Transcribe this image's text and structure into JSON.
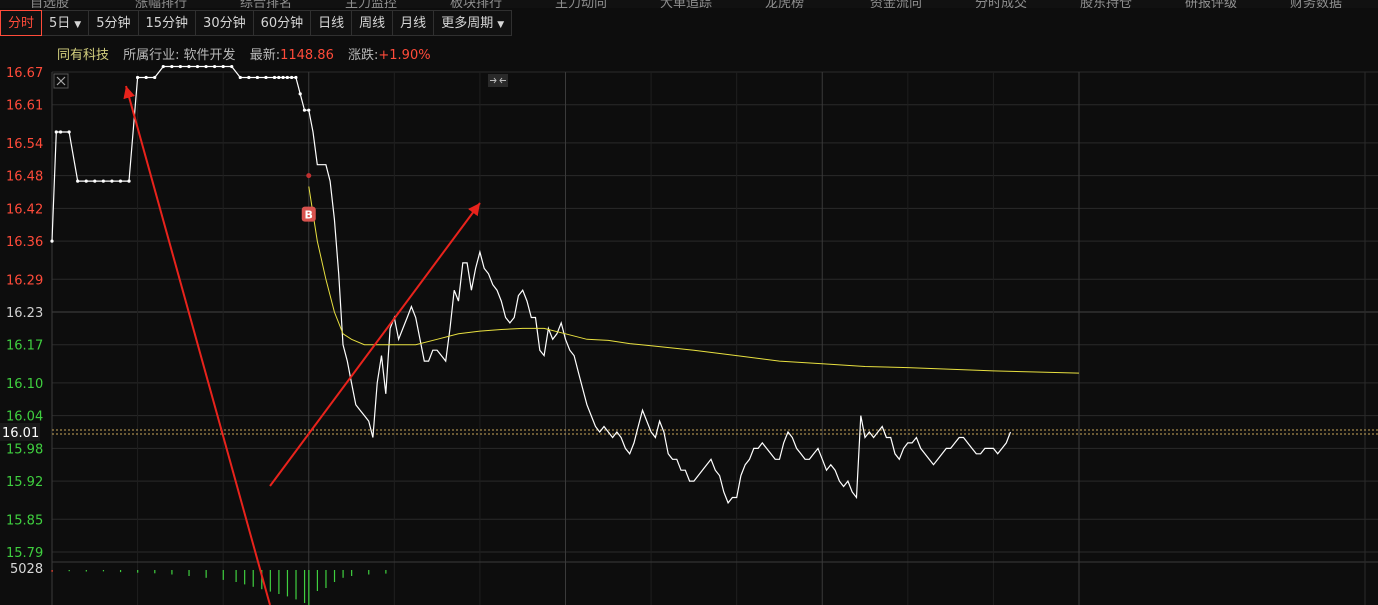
{
  "top_menu": [
    "自选股",
    "涨幅排行",
    "综合排名",
    "主力监控",
    "板块排行",
    "主力动向",
    "大单追踪",
    "龙虎榜",
    "资金流向",
    "分时成交",
    "股东持仓",
    "研报评级",
    "财务数据"
  ],
  "period_tabs": [
    {
      "label": "分时",
      "active": true,
      "dropdown": false
    },
    {
      "label": "5日",
      "active": false,
      "dropdown": true
    },
    {
      "label": "5分钟",
      "active": false,
      "dropdown": false
    },
    {
      "label": "15分钟",
      "active": false,
      "dropdown": false
    },
    {
      "label": "30分钟",
      "active": false,
      "dropdown": false
    },
    {
      "label": "60分钟",
      "active": false,
      "dropdown": false
    },
    {
      "label": "日线",
      "active": false,
      "dropdown": false
    },
    {
      "label": "周线",
      "active": false,
      "dropdown": false
    },
    {
      "label": "月线",
      "active": false,
      "dropdown": false
    },
    {
      "label": "更多周期",
      "active": false,
      "dropdown": true
    }
  ],
  "stock_info": {
    "name": "同有科技",
    "industry_label": "所属行业:",
    "industry": "软件开发",
    "latest_label": "最新:",
    "latest": "1148.86",
    "change_label": "涨跌:",
    "change": "+1.90%"
  },
  "colors": {
    "up": "#ff4b3a",
    "down": "#3fcf3f",
    "price_line": "#ffffff",
    "avg_line": "#e8e040",
    "grid": "#2a2a2a",
    "arrow": "#e8231c"
  },
  "icons": {
    "close": "close-icon",
    "collapse": "collapse-arrows-icon",
    "buy_marker": "buy-marker-icon"
  },
  "buy_marker_label": "B",
  "current_price_label": "16.01",
  "volume_axis_label": "5028",
  "chart_data": {
    "type": "line",
    "title": "",
    "xlabel": "",
    "ylabel": "",
    "ylim": [
      15.79,
      16.67
    ],
    "yticks": [
      16.67,
      16.61,
      16.54,
      16.48,
      16.42,
      16.36,
      16.29,
      16.23,
      16.17,
      16.1,
      16.04,
      15.98,
      15.92,
      15.85,
      15.79
    ],
    "prev_close": 16.23,
    "current_price": 16.01,
    "x_min": 0,
    "x_max": 480,
    "session_break": 120,
    "buy_marker": {
      "x": 120,
      "y": 16.48
    },
    "price_series": {
      "x": [
        0,
        2,
        4,
        8,
        12,
        16,
        20,
        24,
        28,
        32,
        36,
        40,
        44,
        48,
        52,
        56,
        60,
        64,
        68,
        72,
        76,
        80,
        84,
        88,
        92,
        96,
        100,
        104,
        106,
        108,
        110,
        112,
        114,
        116,
        118,
        120,
        122,
        124,
        126,
        128,
        130,
        132,
        134,
        136,
        138,
        140,
        142,
        144,
        146,
        148,
        150,
        152,
        154,
        156,
        158,
        160,
        162,
        164,
        166,
        168,
        170,
        172,
        174,
        176,
        178,
        180,
        182,
        184,
        186,
        188,
        190,
        192,
        194,
        196,
        198,
        200,
        202,
        204,
        206,
        208,
        210,
        212,
        214,
        216,
        218,
        220,
        222,
        224,
        226,
        228,
        230,
        232,
        234,
        236,
        238,
        240,
        242,
        244,
        246,
        248,
        250,
        252,
        254,
        256,
        258,
        260,
        262,
        264,
        266,
        268,
        270,
        272,
        274,
        276,
        278,
        280,
        282,
        284,
        286,
        288,
        290,
        292,
        294,
        296,
        298,
        300,
        302,
        304,
        306,
        308,
        310,
        312,
        314,
        316,
        318,
        320,
        322,
        324,
        326,
        328,
        330,
        332,
        334,
        336,
        338,
        340,
        342,
        344,
        346,
        348,
        350,
        352,
        354,
        356,
        358,
        360,
        362,
        364,
        366,
        368,
        370,
        372,
        374,
        376,
        378,
        380,
        382,
        384,
        386,
        388,
        390,
        392,
        394,
        396,
        398,
        400,
        402,
        404,
        406,
        408,
        410,
        412,
        414,
        416,
        418,
        420,
        422,
        424,
        426,
        428,
        430,
        432,
        434,
        436,
        438,
        440,
        442,
        444,
        446,
        448,
        450,
        452,
        454,
        456,
        458,
        460,
        462,
        464,
        466,
        468,
        470,
        472,
        474,
        476,
        478,
        480
      ],
      "y": [
        16.36,
        16.56,
        16.56,
        16.56,
        16.47,
        16.47,
        16.47,
        16.47,
        16.47,
        16.47,
        16.47,
        16.66,
        16.66,
        16.66,
        16.68,
        16.68,
        16.68,
        16.68,
        16.68,
        16.68,
        16.68,
        16.68,
        16.68,
        16.66,
        16.66,
        16.66,
        16.66,
        16.66,
        16.66,
        16.66,
        16.66,
        16.66,
        16.66,
        16.63,
        16.6,
        16.6,
        16.56,
        16.5,
        16.5,
        16.5,
        16.47,
        16.4,
        16.3,
        16.17,
        16.14,
        16.1,
        16.06,
        16.05,
        16.04,
        16.03,
        16.0,
        16.1,
        16.15,
        16.08,
        16.2,
        16.22,
        16.18,
        16.2,
        16.22,
        16.24,
        16.22,
        16.18,
        16.14,
        16.14,
        16.16,
        16.16,
        16.15,
        16.14,
        16.2,
        16.27,
        16.25,
        16.32,
        16.32,
        16.27,
        16.31,
        16.34,
        16.31,
        16.3,
        16.28,
        16.27,
        16.25,
        16.22,
        16.21,
        16.22,
        16.26,
        16.27,
        16.25,
        16.22,
        16.22,
        16.16,
        16.15,
        16.2,
        16.18,
        16.19,
        16.21,
        16.18,
        16.16,
        16.15,
        16.12,
        16.09,
        16.06,
        16.04,
        16.02,
        16.01,
        16.02,
        16.01,
        16.0,
        16.01,
        16.0,
        15.98,
        15.97,
        15.99,
        16.02,
        16.05,
        16.03,
        16.01,
        16.0,
        16.03,
        16.01,
        15.97,
        15.96,
        15.96,
        15.94,
        15.94,
        15.92,
        15.92,
        15.93,
        15.94,
        15.95,
        15.96,
        15.94,
        15.93,
        15.9,
        15.88,
        15.89,
        15.89,
        15.93,
        15.95,
        15.96,
        15.98,
        15.98,
        15.99,
        15.98,
        15.97,
        15.96,
        15.96,
        15.99,
        16.01,
        16.0,
        15.98,
        15.97,
        15.96,
        15.96,
        15.97,
        15.98,
        15.96,
        15.94,
        15.95,
        15.94,
        15.92,
        15.91,
        15.92,
        15.9,
        15.89,
        16.04,
        16.0,
        16.01,
        16.0,
        16.01,
        16.02,
        16.0,
        16.0,
        15.97,
        15.96,
        15.98,
        15.99,
        15.99,
        16.0,
        15.98,
        15.97,
        15.96,
        15.95,
        15.96,
        15.97,
        15.98,
        15.98,
        15.99,
        16.0,
        16.0,
        15.99,
        15.98,
        15.97,
        15.97,
        15.98,
        15.98,
        15.98,
        15.97,
        15.98,
        15.99,
        16.01
      ]
    },
    "avg_series": {
      "x": [
        120,
        124,
        128,
        132,
        136,
        140,
        146,
        152,
        160,
        170,
        180,
        190,
        200,
        210,
        220,
        230,
        240,
        250,
        260,
        270,
        280,
        300,
        320,
        340,
        360,
        380,
        400,
        420,
        440,
        460,
        480
      ],
      "y": [
        16.46,
        16.36,
        16.29,
        16.23,
        16.19,
        16.18,
        16.17,
        16.17,
        16.17,
        16.17,
        16.18,
        16.19,
        16.195,
        16.198,
        16.2,
        16.2,
        16.19,
        16.18,
        16.178,
        16.172,
        16.168,
        16.16,
        16.15,
        16.14,
        16.135,
        16.13,
        16.128,
        16.125,
        16.122,
        16.12,
        16.118
      ]
    },
    "volume_series": {
      "x": [
        0,
        8,
        16,
        24,
        32,
        40,
        48,
        56,
        64,
        72,
        80,
        86,
        90,
        94,
        98,
        102,
        106,
        110,
        114,
        118,
        120,
        124,
        128,
        132,
        136,
        140,
        148,
        156
      ],
      "values": [
        60,
        40,
        50,
        45,
        70,
        90,
        110,
        150,
        200,
        260,
        330,
        400,
        480,
        560,
        640,
        720,
        800,
        880,
        980,
        1100,
        5028,
        700,
        600,
        400,
        260,
        200,
        150,
        120
      ],
      "direction": [
        "up",
        "down",
        "down",
        "down",
        "down",
        "down",
        "down",
        "down",
        "down",
        "down",
        "down",
        "down",
        "down",
        "down",
        "down",
        "down",
        "down",
        "down",
        "down",
        "down",
        "down",
        "down",
        "down",
        "down",
        "down",
        "down",
        "down",
        "down"
      ]
    }
  }
}
